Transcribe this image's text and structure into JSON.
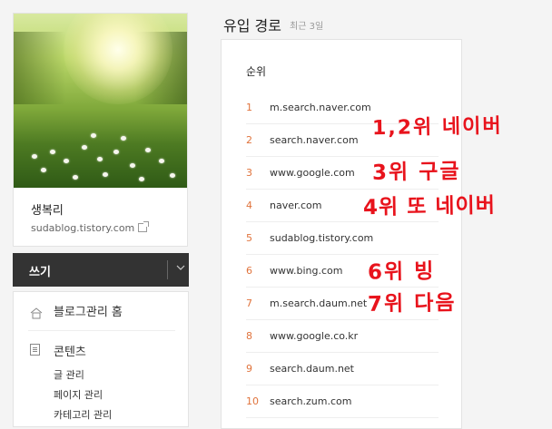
{
  "sidebar": {
    "blog_name": "생복리",
    "blog_url": "sudablog.tistory.com",
    "write_label": "쓰기",
    "menu": {
      "home_label": "블로그관리 홈",
      "contents_label": "콘텐츠",
      "sub_items": [
        "글 관리",
        "페이지 관리",
        "카테고리 관리"
      ]
    }
  },
  "main": {
    "title": "유입 경로",
    "period": "최근 3일",
    "rank_header": "순위",
    "rows": [
      {
        "rank": "1",
        "site": "m.search.naver.com"
      },
      {
        "rank": "2",
        "site": "search.naver.com"
      },
      {
        "rank": "3",
        "site": "www.google.com"
      },
      {
        "rank": "4",
        "site": "naver.com"
      },
      {
        "rank": "5",
        "site": "sudablog.tistory.com"
      },
      {
        "rank": "6",
        "site": "www.bing.com"
      },
      {
        "rank": "7",
        "site": "m.search.daum.net"
      },
      {
        "rank": "8",
        "site": "www.google.co.kr"
      },
      {
        "rank": "9",
        "site": "search.daum.net"
      },
      {
        "rank": "10",
        "site": "search.zum.com"
      }
    ]
  },
  "annotations": [
    "1,2위 네이버",
    "3위 구글",
    "4위 또 네이버",
    "6위 빙",
    "7위 다음"
  ],
  "colors": {
    "rank_number": "#e0733c",
    "annotation": "#e8131c",
    "write_button_bg": "#333333"
  },
  "icons": {
    "home": "home-icon",
    "contents": "document-icon",
    "external_link": "external-link-icon",
    "dropdown": "chevron-down-icon"
  }
}
